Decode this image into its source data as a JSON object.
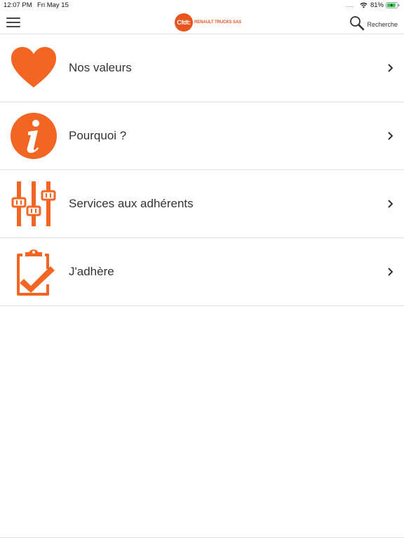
{
  "status_bar": {
    "time": "12:07 PM",
    "date": "Fri May 15",
    "signal_dots": "....",
    "battery_percent": "81%"
  },
  "nav": {
    "menu_icon": "hamburger-icon",
    "logo_badge": "Cfdt:",
    "logo_text": "RENAULT TRUCKS SAS",
    "search_label": "Recherche",
    "search_icon": "magnifier-icon"
  },
  "accent_color": "#e8541d",
  "items": [
    {
      "label": "Nos valeurs",
      "icon": "heart-icon"
    },
    {
      "label": "Pourquoi ?",
      "icon": "info-icon"
    },
    {
      "label": "Services aux adhérents",
      "icon": "sliders-icon"
    },
    {
      "label": "J'adhère",
      "icon": "clipboard-check-icon"
    }
  ]
}
